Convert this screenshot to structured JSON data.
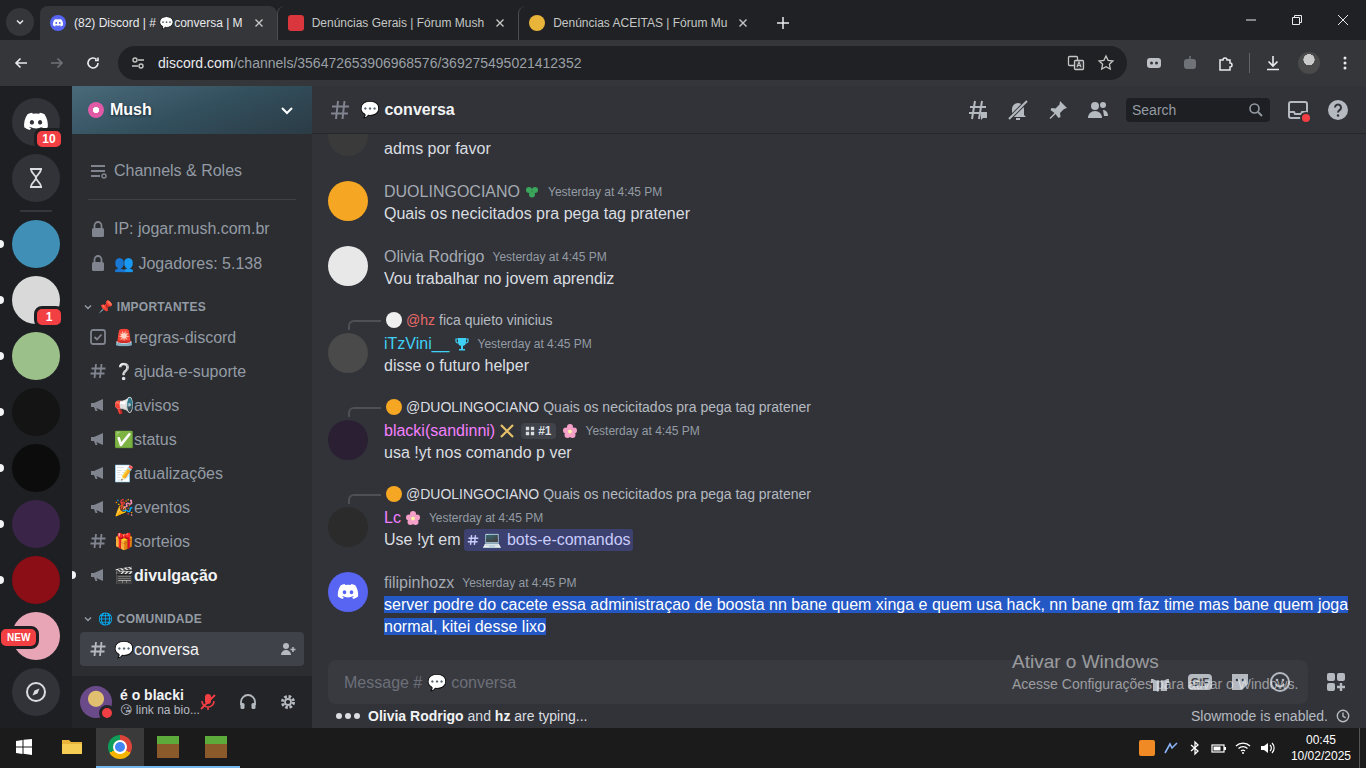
{
  "browser": {
    "tabs": [
      {
        "title": "(82) Discord | # 💬conversa | M",
        "favicon": "discord",
        "selected": true
      },
      {
        "title": "Denúncias Gerais | Fórum Mush",
        "favicon": "forum",
        "selected": false
      },
      {
        "title": "Denúncias ACEITAS | Fórum Mu",
        "favicon": "forum-gold",
        "selected": false
      }
    ],
    "url": {
      "host": "discord.com",
      "path": "/channels/356472653906968576/369275495021412352"
    }
  },
  "rail": {
    "home": {
      "badge": "10"
    },
    "servers": [
      {
        "color": "#3f8fb7",
        "unread": true,
        "badge": null
      },
      {
        "color": "#d9d9d9",
        "unread": true,
        "badge": {
          "text": "1",
          "kind": "count"
        }
      },
      {
        "color": "#9cc08a",
        "unread": true,
        "badge": null
      },
      {
        "color": "#141414",
        "unread": true,
        "badge": null
      },
      {
        "color": "#0c0c0c",
        "unread": true,
        "badge": null
      },
      {
        "color": "#3a2448",
        "unread": true,
        "badge": null
      },
      {
        "color": "#8b0d15",
        "unread": true,
        "badge": null
      },
      {
        "color": "#e8a5b5",
        "unread": false,
        "badge": {
          "text": "NEW",
          "kind": "new"
        }
      }
    ]
  },
  "server": {
    "name": "Mush"
  },
  "sidebar": {
    "items": [
      {
        "kind": "menu",
        "label": "Channels & Roles",
        "selected": false,
        "unread": false
      },
      {
        "kind": "locked",
        "label": "IP: jogar.mush.com.br",
        "selected": false,
        "unread": false
      },
      {
        "kind": "locked",
        "label": "👥 Jogadores: 5.138",
        "selected": false,
        "unread": false
      },
      {
        "kind": "category",
        "label": "📌 IMPORTANTES",
        "selected": false,
        "unread": false
      },
      {
        "kind": "rules",
        "label": "🚨regras-discord",
        "selected": false,
        "unread": false
      },
      {
        "kind": "text",
        "label": "❔ajuda-e-suporte",
        "selected": false,
        "unread": false
      },
      {
        "kind": "announcement",
        "label": "📢avisos",
        "selected": false,
        "unread": false
      },
      {
        "kind": "announcement",
        "label": "✅status",
        "selected": false,
        "unread": false
      },
      {
        "kind": "announcement",
        "label": "📝atualizações",
        "selected": false,
        "unread": false
      },
      {
        "kind": "announcement",
        "label": "🎉eventos",
        "selected": false,
        "unread": false
      },
      {
        "kind": "text",
        "label": "🎁sorteios",
        "selected": false,
        "unread": false
      },
      {
        "kind": "announcement",
        "label": "🎬divulgação",
        "selected": false,
        "unread": true
      },
      {
        "kind": "category",
        "label": "🌐 COMUNIDADE",
        "selected": false,
        "unread": false
      },
      {
        "kind": "text",
        "label": "💬conversa",
        "selected": true,
        "unread": false
      }
    ]
  },
  "user": {
    "name": "é o blacki",
    "status": "😘 link na bio..."
  },
  "chat": {
    "channel": "💬 conversa",
    "search_placeholder": "Search",
    "messages": [
      {
        "kind": "continuation",
        "default_avatar": false,
        "avatar_color": "#3a3a3a",
        "text": "adms por favor",
        "selected": false
      },
      {
        "kind": "message",
        "default_avatar": false,
        "avatar_color": "#f5a623",
        "author": "DUOLINGOCIANO",
        "color": "#a5aab3",
        "badges": [
          {
            "kind": "leaf"
          }
        ],
        "time": "Yesterday at 4:45 PM",
        "text": "Quais os necicitados pra pega tag pratener",
        "selected": false
      },
      {
        "kind": "message",
        "default_avatar": false,
        "avatar_color": "#e8e8e8",
        "author": "Olivia Rodrigo",
        "color": "#a5aab3",
        "badges": [],
        "time": "Yesterday at 4:45 PM",
        "text": "Vou trabalhar no jovem aprendiz",
        "selected": false
      },
      {
        "kind": "message",
        "default_avatar": false,
        "reply": {
          "author": "@hz",
          "color": "#e86a6a",
          "avatar_color": "#f0f0f0",
          "text": "fica quieto vinicius"
        },
        "avatar_color": "#4a4a4a",
        "author": "iTzVini__",
        "color": "#3fd0f5",
        "badges": [
          {
            "kind": "trophy"
          }
        ],
        "time": "Yesterday at 4:45 PM",
        "text": "disse o futuro helper",
        "selected": false
      },
      {
        "kind": "message",
        "default_avatar": false,
        "reply": {
          "author": "@DUOLINGOCIANO",
          "color": "#dbdee1",
          "avatar_color": "#f5a623",
          "text": "Quais os necicitados pra pega tag pratener"
        },
        "avatar_color": "#2a1f33",
        "author": "blacki(sandinni)",
        "color": "#f47fff",
        "badges": [
          {
            "kind": "swords"
          },
          {
            "kind": "tag",
            "text": "#1"
          },
          {
            "kind": "flower"
          }
        ],
        "time": "Yesterday at 4:45 PM",
        "text": "usa !yt nos comando p ver",
        "selected": false
      },
      {
        "kind": "message",
        "default_avatar": false,
        "reply": {
          "author": "@DUOLINGOCIANO",
          "color": "#dbdee1",
          "avatar_color": "#f5a623",
          "text": "Quais os necicitados pra pega tag pratener"
        },
        "avatar_color": "#2b2b2b",
        "author": "Lc",
        "color": "#f47fff",
        "badges": [
          {
            "kind": "flower"
          }
        ],
        "time": "Yesterday at 4:45 PM",
        "text": "Use !yt em",
        "mention": "💻 bots-e-comandos",
        "selected": false
      },
      {
        "kind": "message",
        "default_avatar": true,
        "avatar_color": "#5865f2",
        "author": "filipinhozx",
        "color": "#a5aab3",
        "badges": [],
        "time": "Yesterday at 4:45 PM",
        "text": "server podre do cacete essa administraçao de boosta nn bane quem xinga e quem usa hack, nn bane qm faz time mas bane quem joga normal, kitei desse lixo",
        "selected": true
      }
    ],
    "input_placeholder": "Message # 💬 conversa",
    "gif_label": "GIF",
    "typing": {
      "names": [
        "Olivia Rodrigo",
        "hz"
      ],
      "joiner": "and",
      "suffix": "are typing..."
    },
    "slowmode": "Slowmode is enabled."
  },
  "watermark": {
    "title": "Ativar o Windows",
    "text": "Acesse Configurações para ativar o Windows."
  },
  "taskbar": {
    "apps": [
      {
        "kind": "explorer",
        "running": false,
        "active": false
      },
      {
        "kind": "chrome",
        "running": true,
        "active": true
      },
      {
        "kind": "minecraft",
        "running": true,
        "active": false
      },
      {
        "kind": "minecraft",
        "running": true,
        "active": false
      }
    ],
    "time": "00:45",
    "date": "10/02/2025"
  }
}
